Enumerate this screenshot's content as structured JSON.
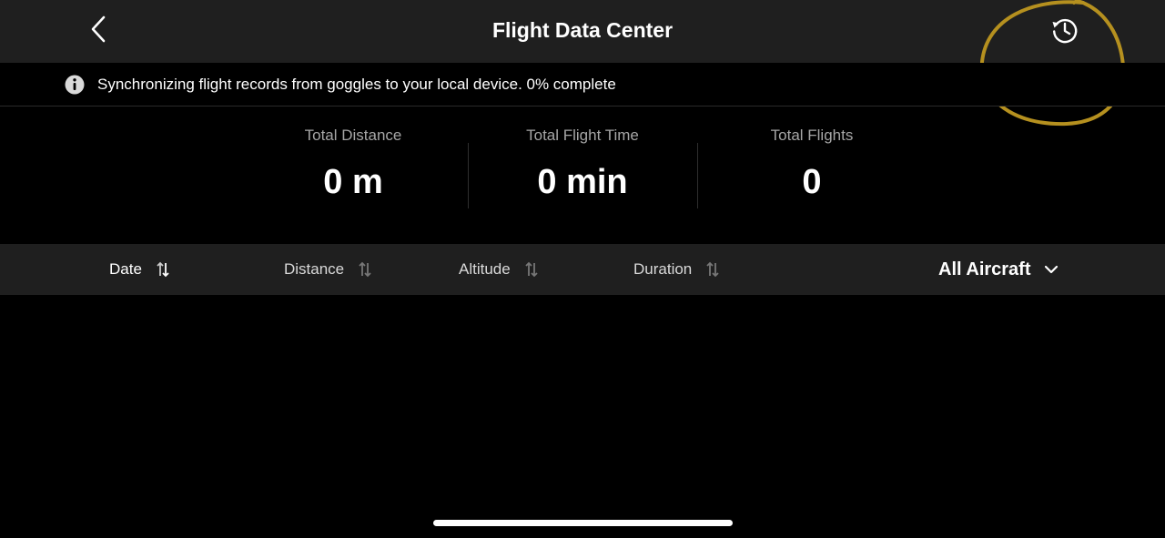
{
  "header": {
    "title": "Flight Data Center",
    "back_icon": "chevron-left-icon",
    "history_icon": "history-clock-icon",
    "annotation_color": "#b5901f"
  },
  "sync_banner": {
    "icon": "info-icon",
    "message": "Synchronizing flight records from goggles to your local device. 0% complete"
  },
  "stats": [
    {
      "label": "Total Distance",
      "value": "0 m"
    },
    {
      "label": "Total Flight Time",
      "value": "0 min"
    },
    {
      "label": "Total Flights",
      "value": "0"
    }
  ],
  "sort_bar": {
    "columns": [
      {
        "label": "Date",
        "active": true
      },
      {
        "label": "Distance",
        "active": false
      },
      {
        "label": "Altitude",
        "active": false
      },
      {
        "label": "Duration",
        "active": false
      }
    ],
    "filter": {
      "label": "All Aircraft",
      "icon": "chevron-down-icon"
    }
  },
  "colors": {
    "background": "#000000",
    "bar": "#1f1f1f",
    "muted_text": "#a6a6a6"
  }
}
